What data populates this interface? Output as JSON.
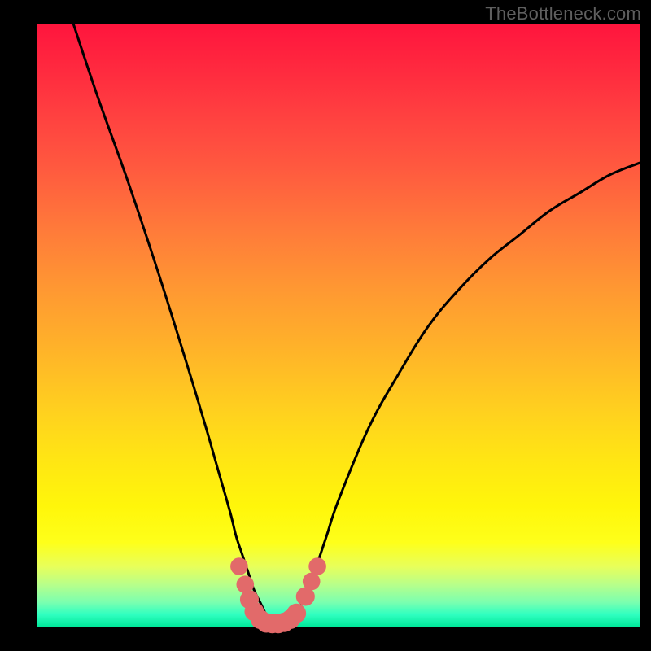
{
  "watermark": "TheBottleneck.com",
  "colors": {
    "frame": "#000000",
    "curve": "#000000",
    "markers": "#e26a6a",
    "gradient_top": "#ff153d",
    "gradient_bottom": "#00e89a"
  },
  "chart_data": {
    "type": "line",
    "title": "",
    "xlabel": "",
    "ylabel": "",
    "xlim": [
      0,
      100
    ],
    "ylim": [
      0,
      100
    ],
    "grid": false,
    "series": [
      {
        "name": "bottleneck-curve",
        "x": [
          6,
          10,
          15,
          20,
          25,
          28,
          30,
          32,
          33,
          34,
          35,
          36,
          37,
          38,
          39,
          40,
          41,
          42,
          43,
          44,
          45,
          46,
          48,
          50,
          55,
          60,
          65,
          70,
          75,
          80,
          85,
          90,
          95,
          100
        ],
        "y": [
          100,
          88,
          74,
          59,
          43,
          33,
          26,
          19,
          15,
          12,
          9,
          6,
          4,
          2,
          1,
          0.5,
          0.5,
          1,
          2,
          4,
          6,
          9,
          15,
          21,
          33,
          42,
          50,
          56,
          61,
          65,
          69,
          72,
          75,
          77
        ]
      }
    ],
    "markers": [
      {
        "x": 33.5,
        "y": 10,
        "r": 1.3
      },
      {
        "x": 34.5,
        "y": 7,
        "r": 1.3
      },
      {
        "x": 35.2,
        "y": 4.5,
        "r": 1.5
      },
      {
        "x": 36,
        "y": 2.5,
        "r": 1.6
      },
      {
        "x": 37,
        "y": 1.2,
        "r": 1.6
      },
      {
        "x": 38,
        "y": 0.6,
        "r": 1.6
      },
      {
        "x": 39,
        "y": 0.5,
        "r": 1.6
      },
      {
        "x": 40,
        "y": 0.5,
        "r": 1.6
      },
      {
        "x": 41,
        "y": 0.7,
        "r": 1.6
      },
      {
        "x": 42,
        "y": 1.2,
        "r": 1.6
      },
      {
        "x": 43,
        "y": 2.2,
        "r": 1.6
      },
      {
        "x": 44.5,
        "y": 5,
        "r": 1.5
      },
      {
        "x": 45.5,
        "y": 7.5,
        "r": 1.3
      },
      {
        "x": 46.5,
        "y": 10,
        "r": 1.3
      }
    ]
  }
}
